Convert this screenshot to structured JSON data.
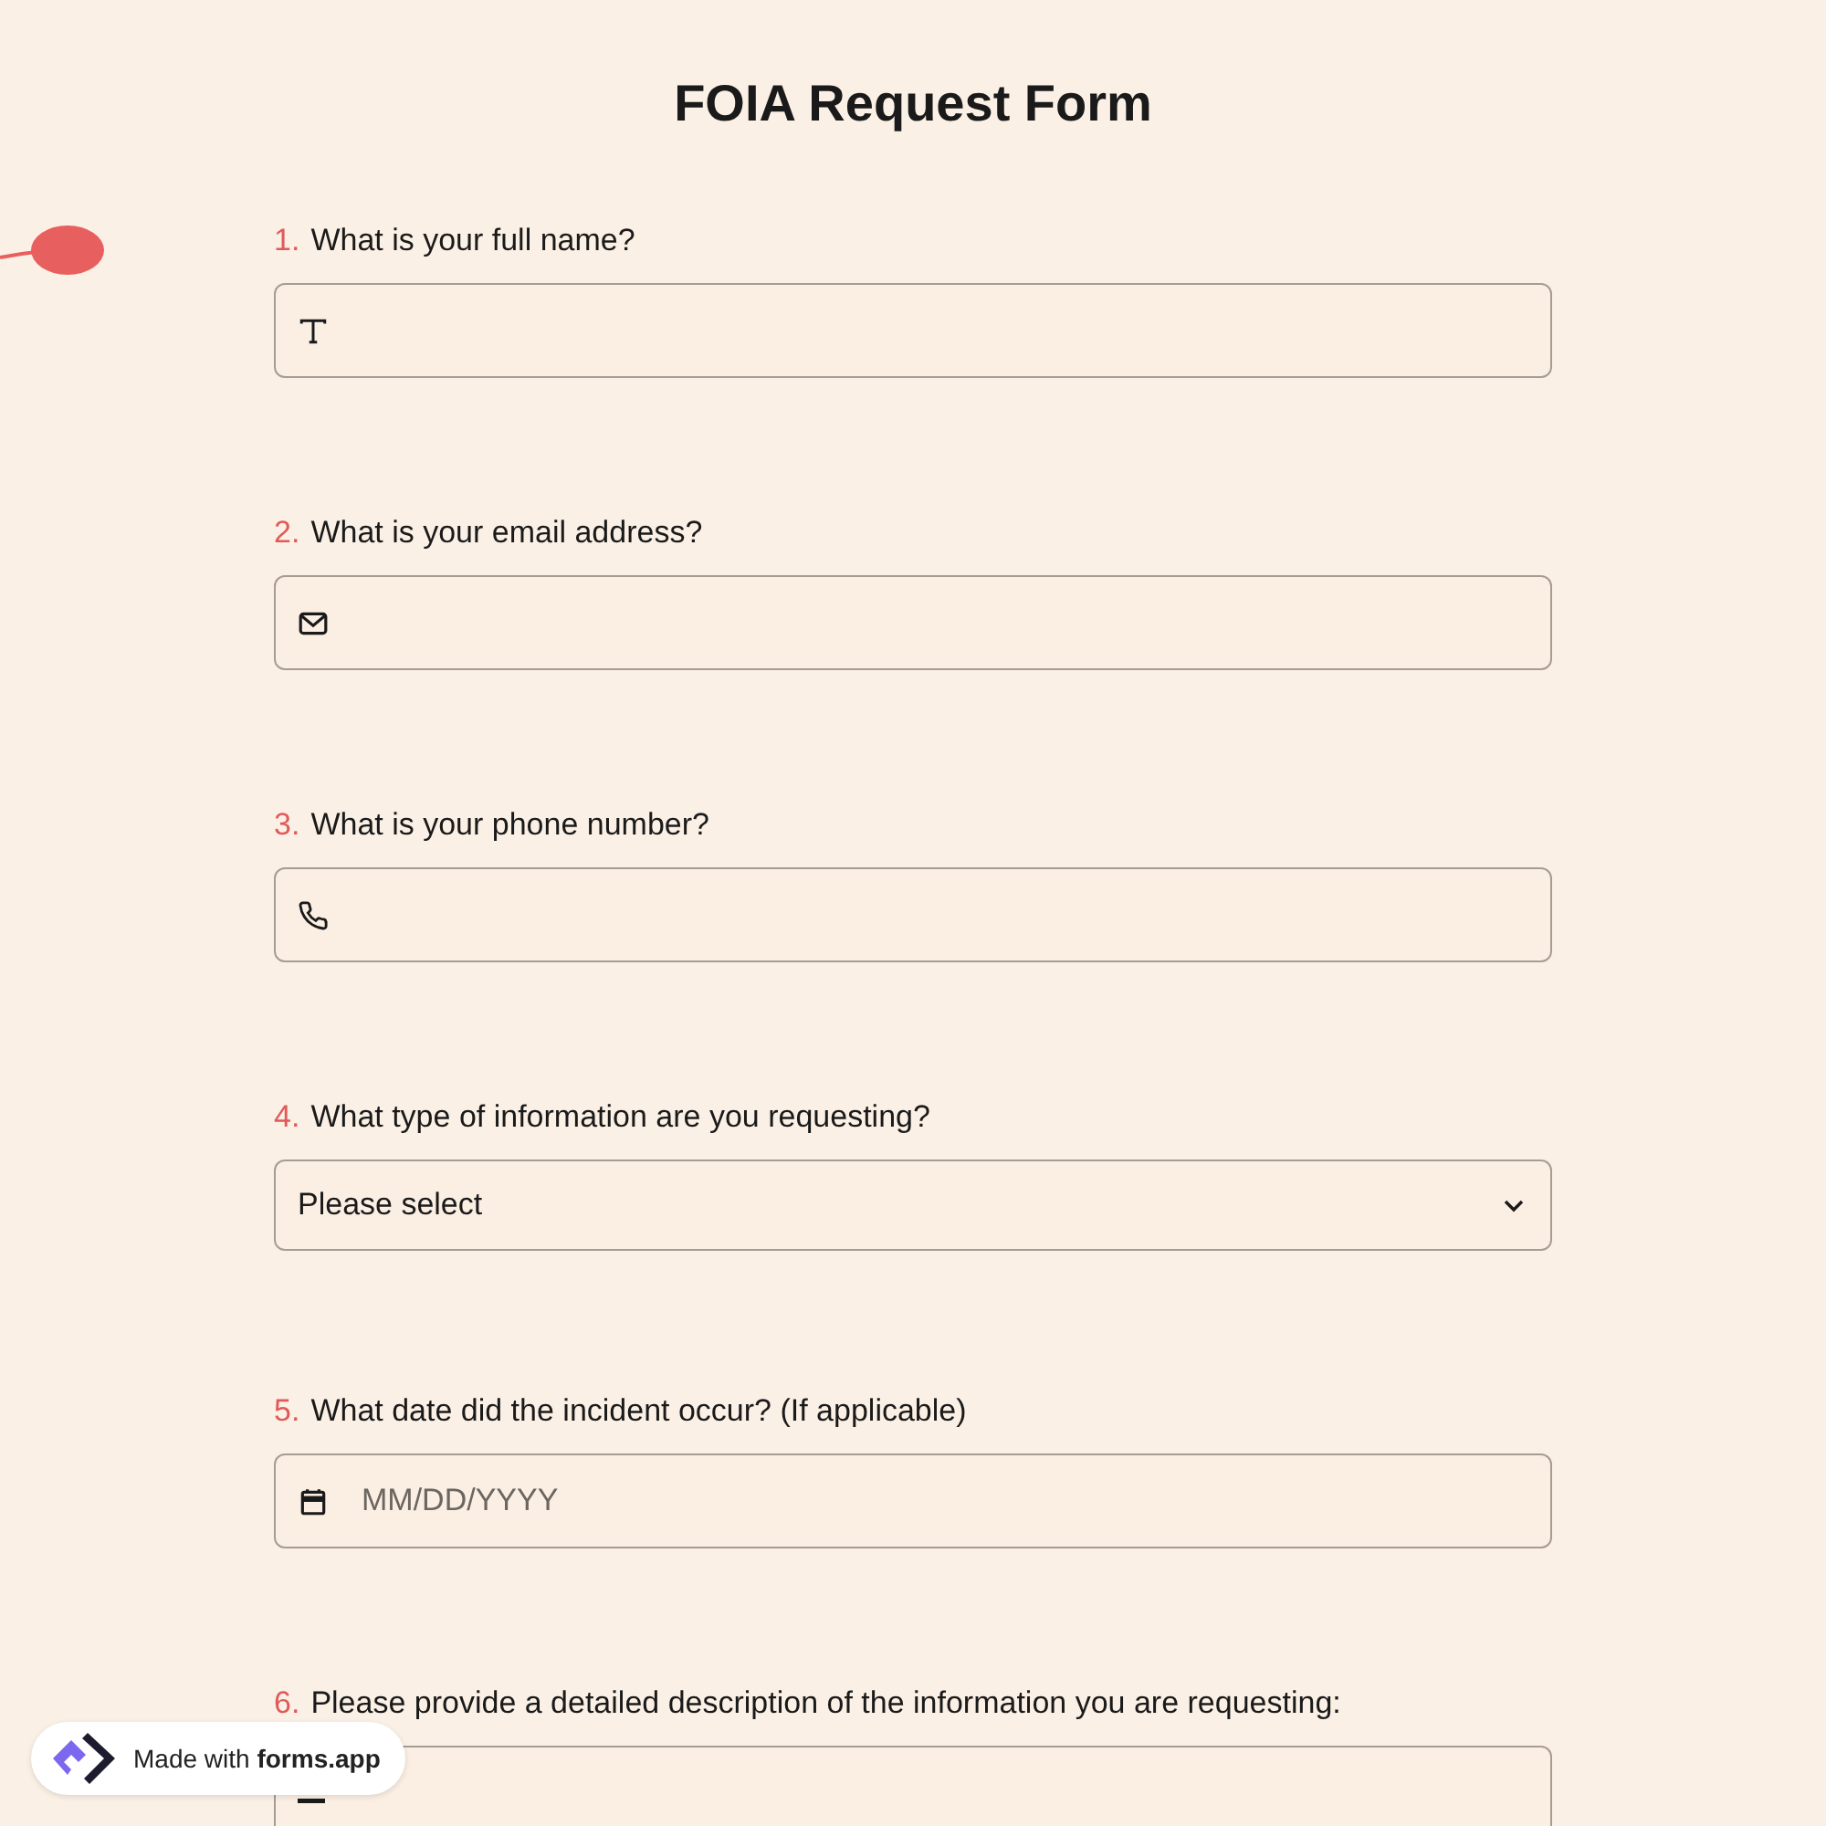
{
  "title": "FOIA Request Form",
  "questions": [
    {
      "number": "1.",
      "label": "What is your full name?",
      "kind": "text"
    },
    {
      "number": "2.",
      "label": "What is your email address?",
      "kind": "email"
    },
    {
      "number": "3.",
      "label": "What is your phone number?",
      "kind": "phone"
    },
    {
      "number": "4.",
      "label": "What type of information are you requesting?",
      "kind": "select",
      "value": "Please select"
    },
    {
      "number": "5.",
      "label": "What date did the incident occur? (If applicable)",
      "kind": "date",
      "placeholder": "MM/DD/YYYY"
    },
    {
      "number": "6.",
      "label": "Please provide a detailed description of the information you are requesting:",
      "kind": "textarea"
    }
  ],
  "badge": {
    "text": "Made with **forms.app**"
  }
}
